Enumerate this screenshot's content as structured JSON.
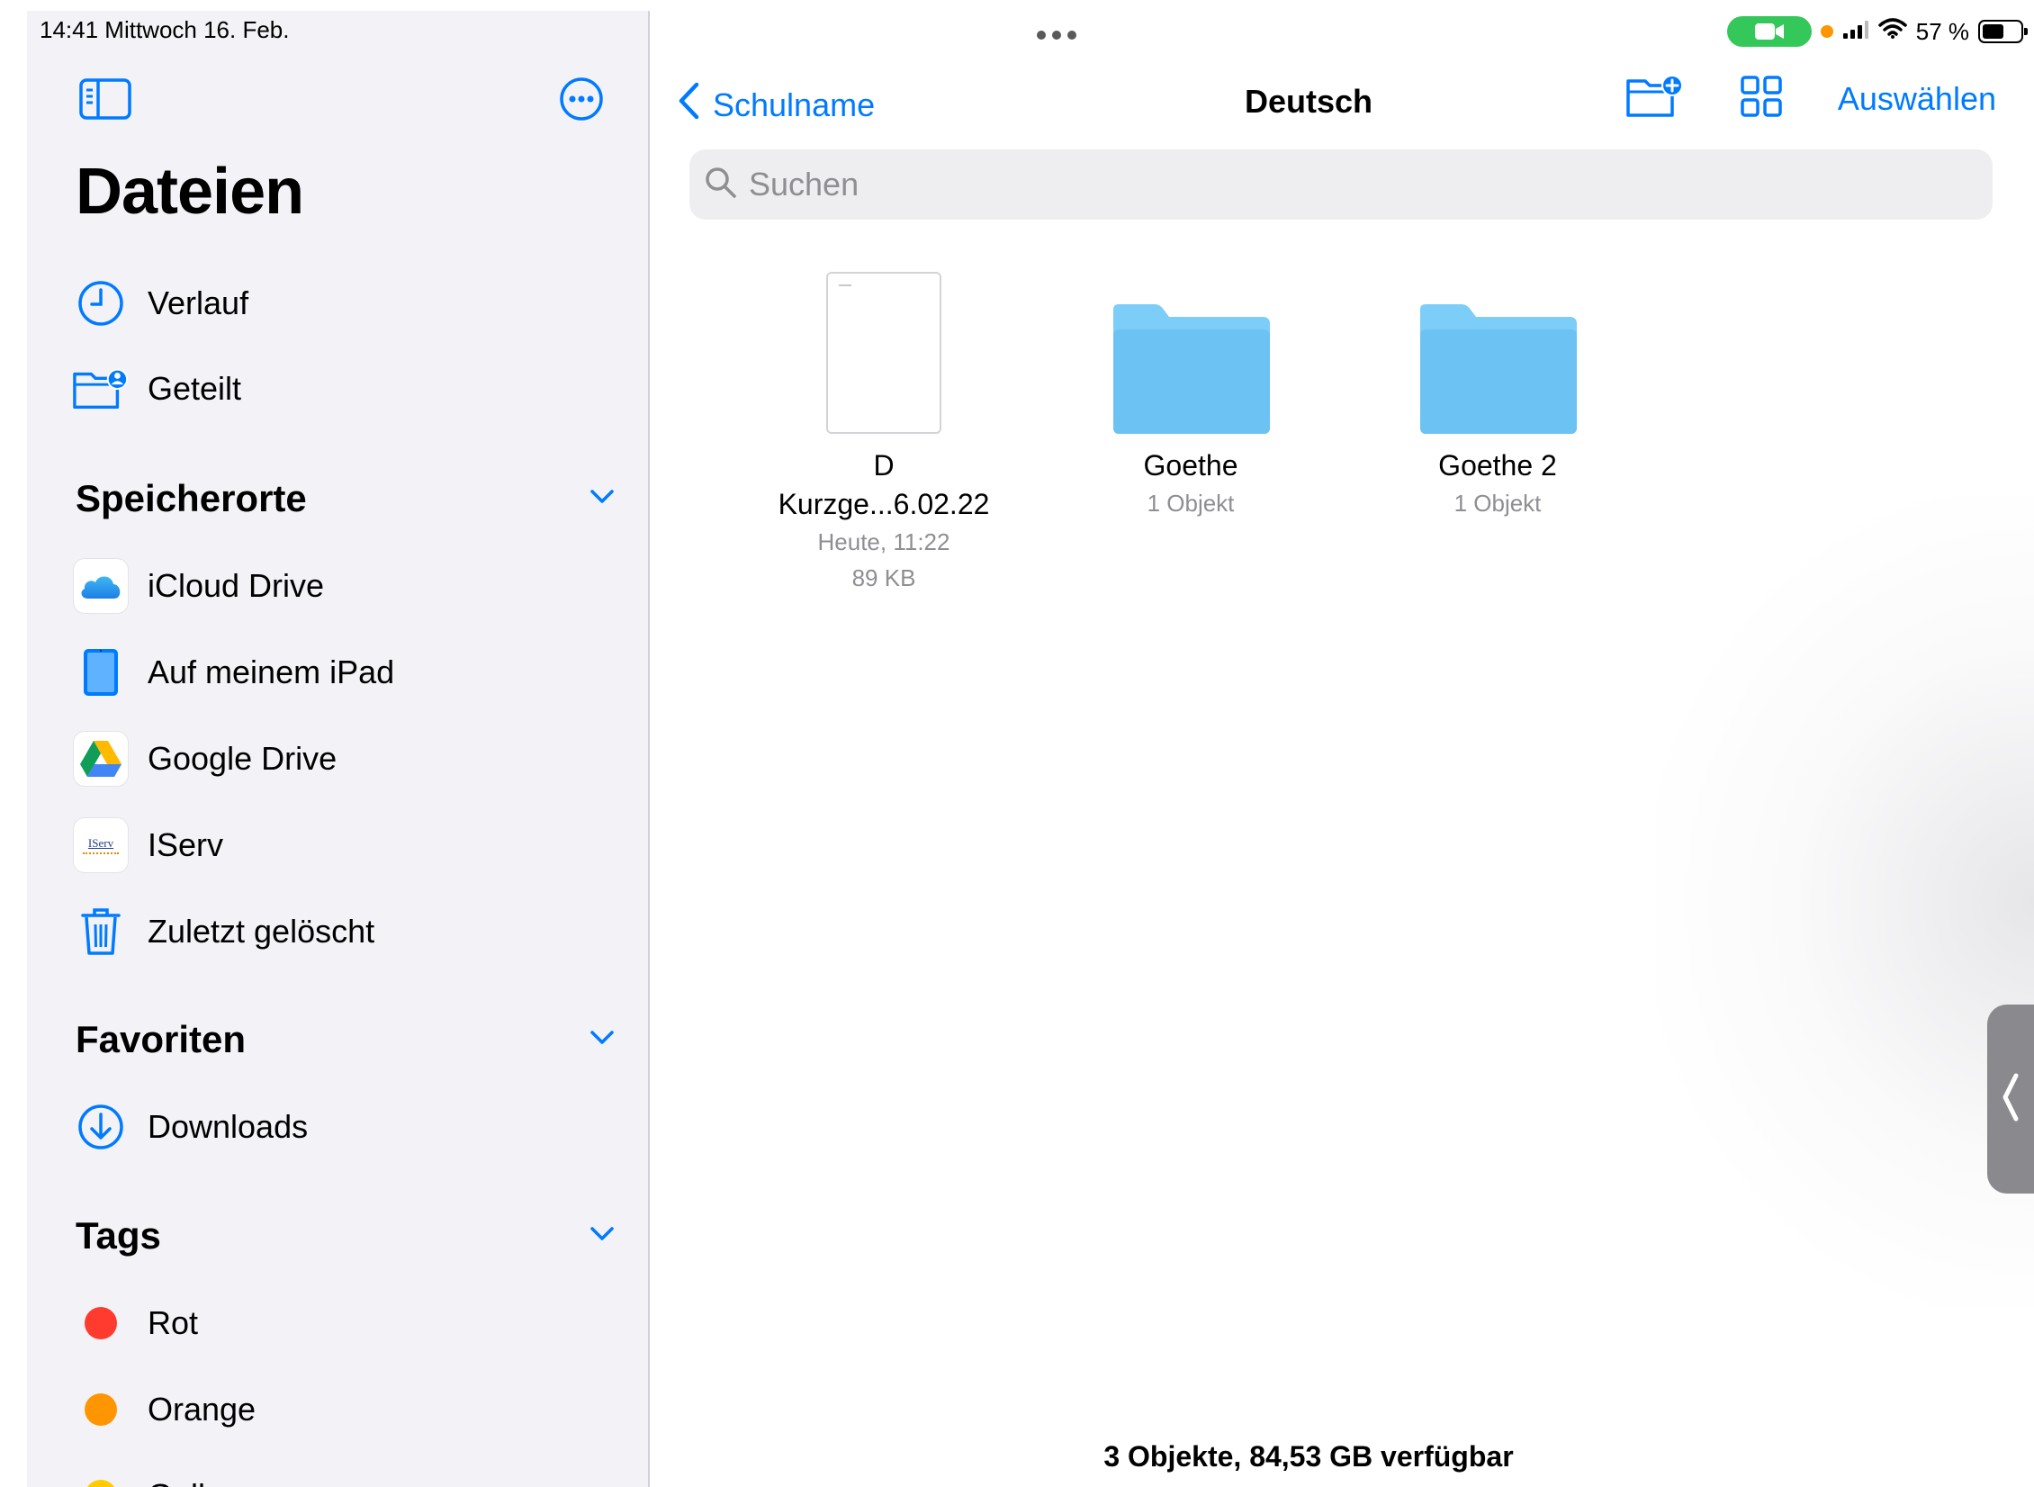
{
  "status_bar": {
    "time_date": "14:41   Mittwoch 16. Feb.",
    "battery_percent": "57 %",
    "battery_level": 0.57
  },
  "sidebar": {
    "title": "Dateien",
    "recents": [
      {
        "label": "Verlauf",
        "icon": "clock-icon"
      },
      {
        "label": "Geteilt",
        "icon": "shared-folder-icon"
      }
    ],
    "locations": {
      "heading": "Speicherorte",
      "items": [
        {
          "label": "iCloud Drive",
          "icon": "icloud-icon"
        },
        {
          "label": "Auf meinem iPad",
          "icon": "ipad-icon"
        },
        {
          "label": "Google Drive",
          "icon": "google-drive-icon"
        },
        {
          "label": "IServ",
          "icon": "iserv-icon",
          "logo_text": "IServ"
        },
        {
          "label": "Zuletzt gelöscht",
          "icon": "trash-icon"
        }
      ]
    },
    "favorites": {
      "heading": "Favoriten",
      "items": [
        {
          "label": "Downloads",
          "icon": "download-icon"
        }
      ]
    },
    "tags": {
      "heading": "Tags",
      "items": [
        {
          "label": "Rot",
          "color": "#ff3b30"
        },
        {
          "label": "Orange",
          "color": "#ff9500"
        },
        {
          "label": "Gelb",
          "color": "#ffcc00"
        }
      ]
    }
  },
  "main": {
    "back_label": "Schulname",
    "title": "Deutsch",
    "select_label": "Auswählen",
    "search_placeholder": "Suchen",
    "items": [
      {
        "type": "document",
        "name_line1": "D",
        "name_line2": "Kurzge...6.02.22",
        "date": "Heute, 11:22",
        "size": "89 KB"
      },
      {
        "type": "folder",
        "name": "Goethe",
        "count": "1 Objekt"
      },
      {
        "type": "folder",
        "name": "Goethe 2",
        "count": "1 Objekt"
      }
    ],
    "footer": "3 Objekte, 84,53 GB verfügbar"
  },
  "colors": {
    "accent": "#007aff",
    "sidebar_bg": "#f2f2f7",
    "folder": "#7ccdf7",
    "facetime_pill": "#34c759"
  }
}
